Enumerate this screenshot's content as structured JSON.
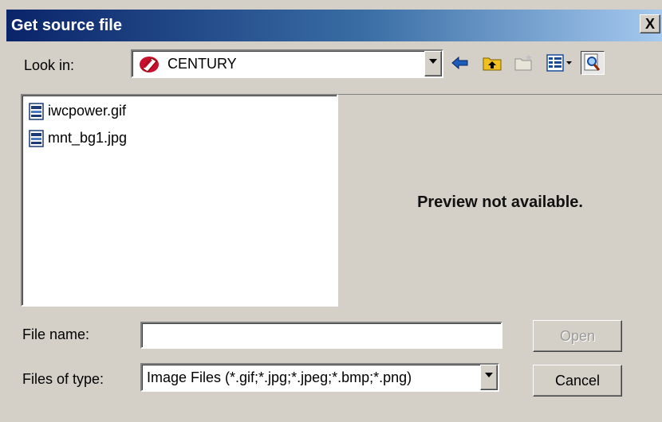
{
  "window": {
    "title": "Get source file",
    "close_glyph": "X"
  },
  "look_in": {
    "label": "Look in:",
    "value": "CENTURY",
    "icon": "drive-icon"
  },
  "toolbar": {
    "back_icon": "back-arrow-icon",
    "up_icon": "up-folder-icon",
    "new_folder_icon": "new-folder-icon",
    "view_menu_icon": "view-menu-icon",
    "preview_icon": "preview-icon"
  },
  "files": [
    {
      "name": "iwcpower.gif",
      "icon": "image-file-icon"
    },
    {
      "name": "mnt_bg1.jpg",
      "icon": "image-file-icon"
    }
  ],
  "preview": {
    "message": "Preview not available."
  },
  "file_name": {
    "label": "File name:",
    "value": ""
  },
  "file_type": {
    "label": "Files of type:",
    "value": "Image Files (*.gif;*.jpg;*.jpeg;*.bmp;*.png)"
  },
  "buttons": {
    "open": "Open",
    "cancel": "Cancel"
  },
  "colors": {
    "title_start": "#0a246a",
    "title_end": "#a6caf0",
    "face": "#d4d0c8"
  }
}
